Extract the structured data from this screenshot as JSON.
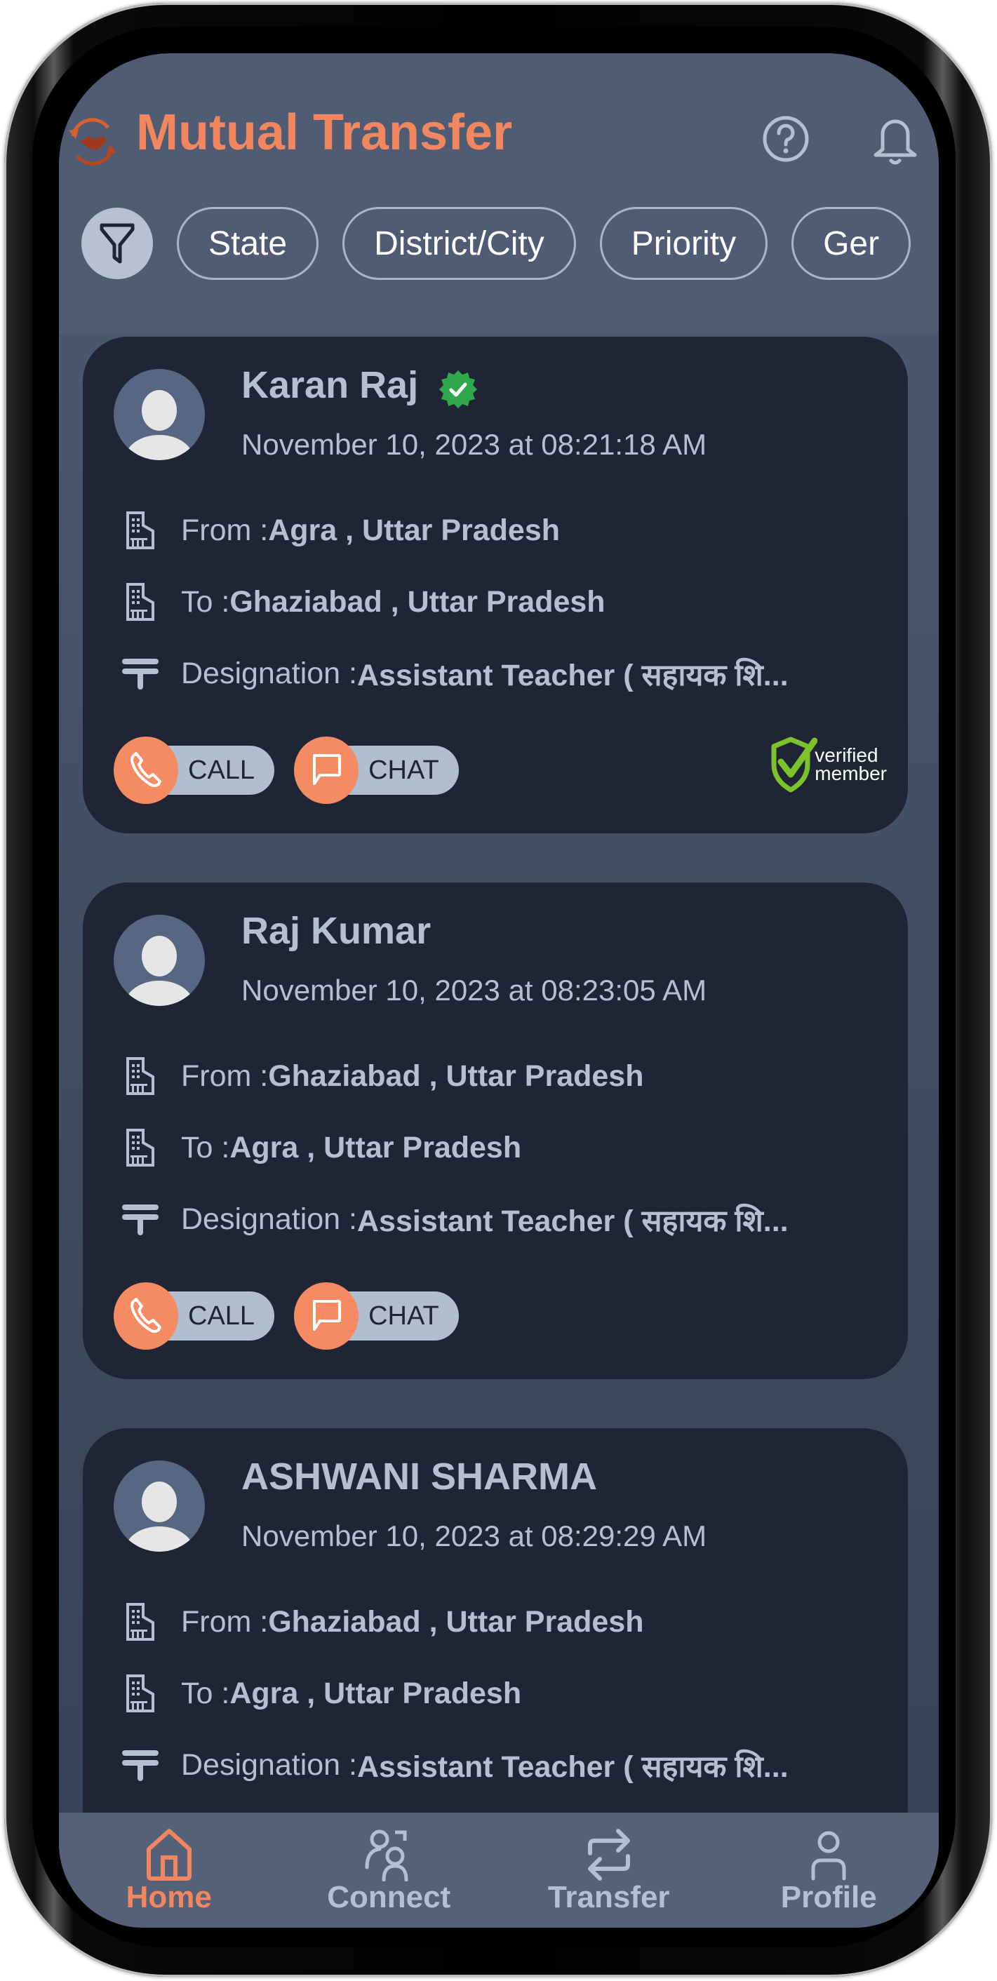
{
  "app": {
    "title": "Mutual Transfer",
    "accent_color": "#f2875f",
    "logo_icon": "handshake-transfer-logo"
  },
  "header": {
    "help_icon": "help-circle-icon",
    "notification_icon": "bell-icon"
  },
  "filters": {
    "filter_icon": "filter-icon",
    "chips": [
      {
        "label": "State"
      },
      {
        "label": "District/City"
      },
      {
        "label": "Priority"
      },
      {
        "label": "Ger"
      }
    ]
  },
  "cards": [
    {
      "name": "Karan Raj",
      "verified": true,
      "timestamp": "November 10, 2023 at 08:21:18 AM",
      "from_label": "From : ",
      "from_value": "Agra , Uttar Pradesh",
      "to_label": "To : ",
      "to_value": "Ghaziabad , Uttar Pradesh",
      "designation_label": "Designation : ",
      "designation_value": "Assistant Teacher ( सहायक शि...",
      "call_label": "CALL",
      "chat_label": "CHAT",
      "verified_member_line1": "verified",
      "verified_member_line2": "member"
    },
    {
      "name": "Raj Kumar",
      "verified": false,
      "timestamp": "November 10, 2023 at 08:23:05 AM",
      "from_label": "From : ",
      "from_value": "Ghaziabad , Uttar Pradesh",
      "to_label": "To : ",
      "to_value": "Agra , Uttar Pradesh",
      "designation_label": "Designation : ",
      "designation_value": "Assistant Teacher ( सहायक शि...",
      "call_label": "CALL",
      "chat_label": "CHAT"
    },
    {
      "name": "ASHWANI SHARMA",
      "verified": false,
      "timestamp": "November 10, 2023 at 08:29:29 AM",
      "from_label": "From : ",
      "from_value": "Ghaziabad , Uttar Pradesh",
      "to_label": "To : ",
      "to_value": "Agra , Uttar Pradesh",
      "designation_label": "Designation : ",
      "designation_value": "Assistant Teacher ( सहायक शि..."
    }
  ],
  "bottom_nav": {
    "active": "Home",
    "items": [
      {
        "label": "Home",
        "icon": "home-icon"
      },
      {
        "label": "Connect",
        "icon": "users-icon"
      },
      {
        "label": "Transfer",
        "icon": "transfer-arrows-icon"
      },
      {
        "label": "Profile",
        "icon": "user-icon"
      }
    ]
  }
}
